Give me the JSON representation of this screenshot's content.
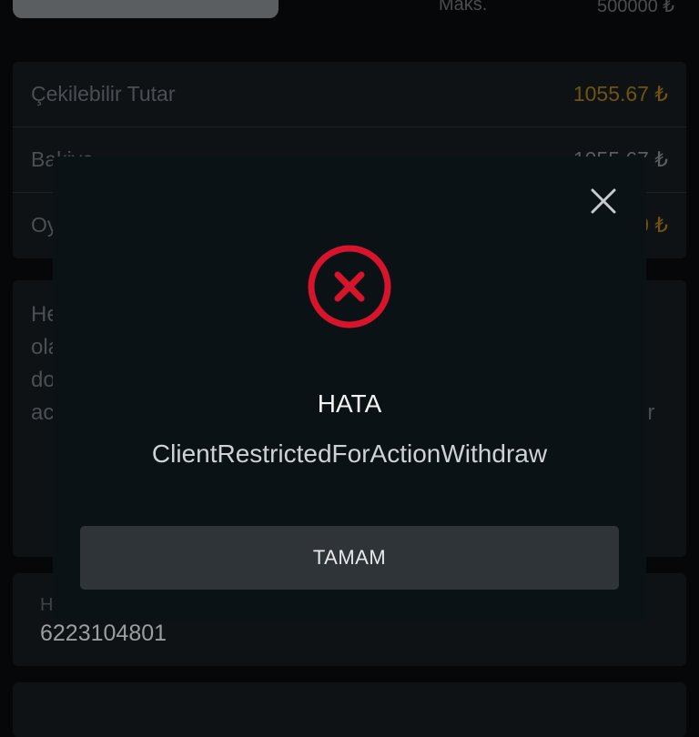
{
  "header": {
    "maks_label": "Maks.",
    "maks_value": "500000 ₺"
  },
  "balances": [
    {
      "label": "Çekilebilir Tutar",
      "value": "1055.67 ₺",
      "color": "#6e5410"
    },
    {
      "label": "Bakiye",
      "value": "1055.67 ₺",
      "color": "#5a5d60"
    },
    {
      "label": "Oy",
      "value": "0 ₺",
      "color": "#6e5410"
    }
  ],
  "info": {
    "line1": "He",
    "line2": "ola",
    "line3": "do",
    "line4": "ac",
    "line4_tail": "ir"
  },
  "account_field": {
    "label": "H",
    "value": "6223104801"
  },
  "modal": {
    "close_icon": "close-icon",
    "status_icon": "error-x-circle-icon",
    "title": "HATA",
    "message": "ClientRestrictedForActionWithdraw",
    "ok_label": "TAMAM",
    "error_color": "#d7142b"
  }
}
